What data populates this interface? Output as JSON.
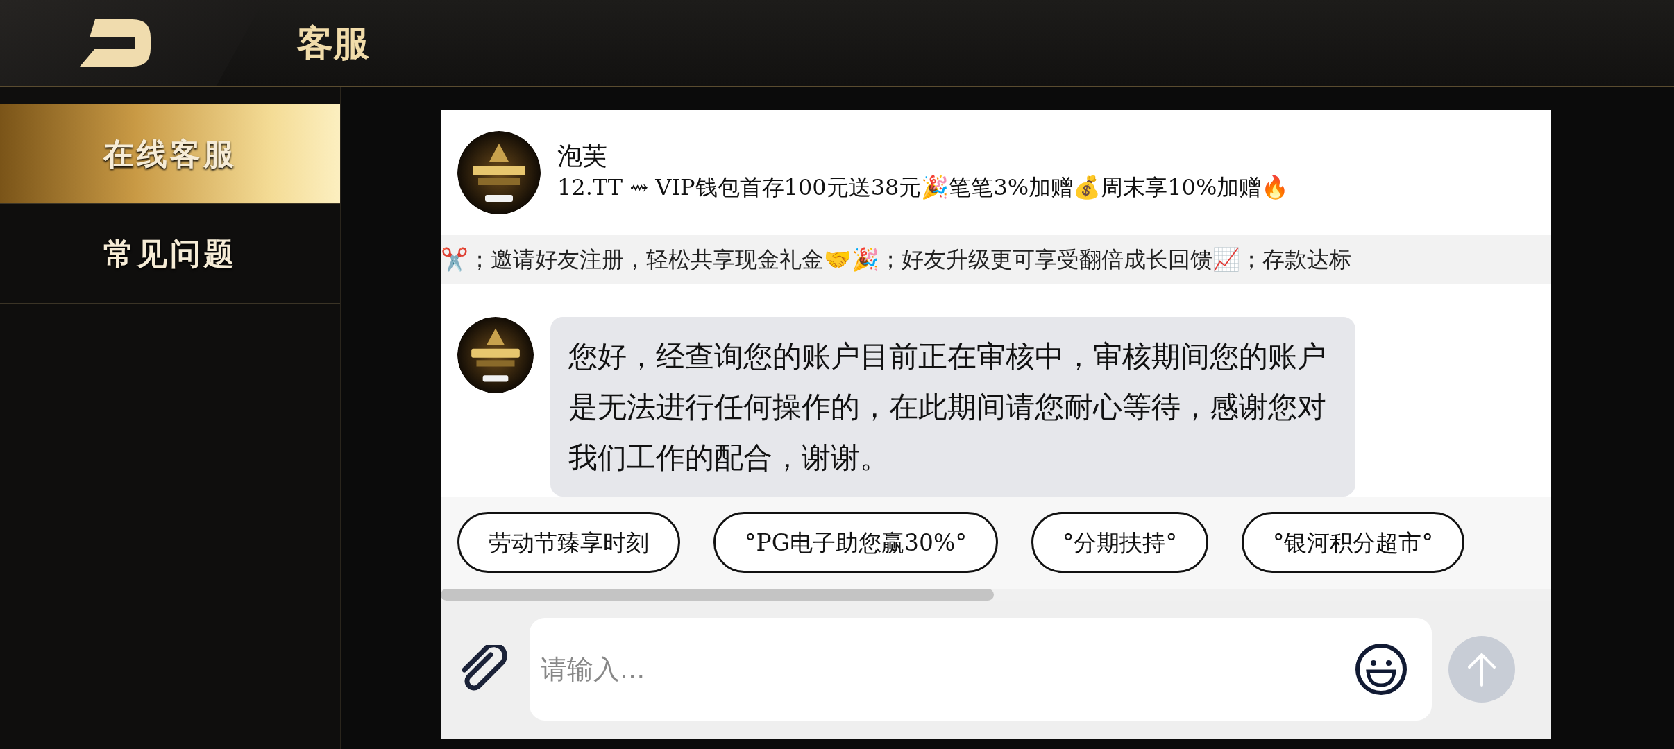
{
  "header": {
    "title": "客服"
  },
  "sidebar": {
    "items": [
      {
        "label": "在线客服",
        "selected": true
      },
      {
        "label": "常见问题",
        "selected": false
      }
    ]
  },
  "chat": {
    "agent_name": "泡芙",
    "agent_tagline": "12.TT ⇝ VIP钱包首存100元送38元🎉笔笔3%加赠💰周末享10%加赠🔥",
    "marquee": "✂️；邀请好友注册，轻松共享现金礼金🤝🎉；好友升级更可享受翻倍成长回馈📈；存款达标",
    "messages": [
      {
        "text": "您好，经查询您的账户目前正在审核中，审核期间您的账户是无法进行任何操作的，在此期间请您耐心等待，感谢您对我们工作的配合，谢谢。"
      }
    ],
    "quick_replies": [
      "劳动节臻享时刻",
      "°PG电子助您赢30%°",
      "°分期扶持°",
      "°银河积分超市°"
    ],
    "input": {
      "placeholder": "请输入..."
    }
  }
}
